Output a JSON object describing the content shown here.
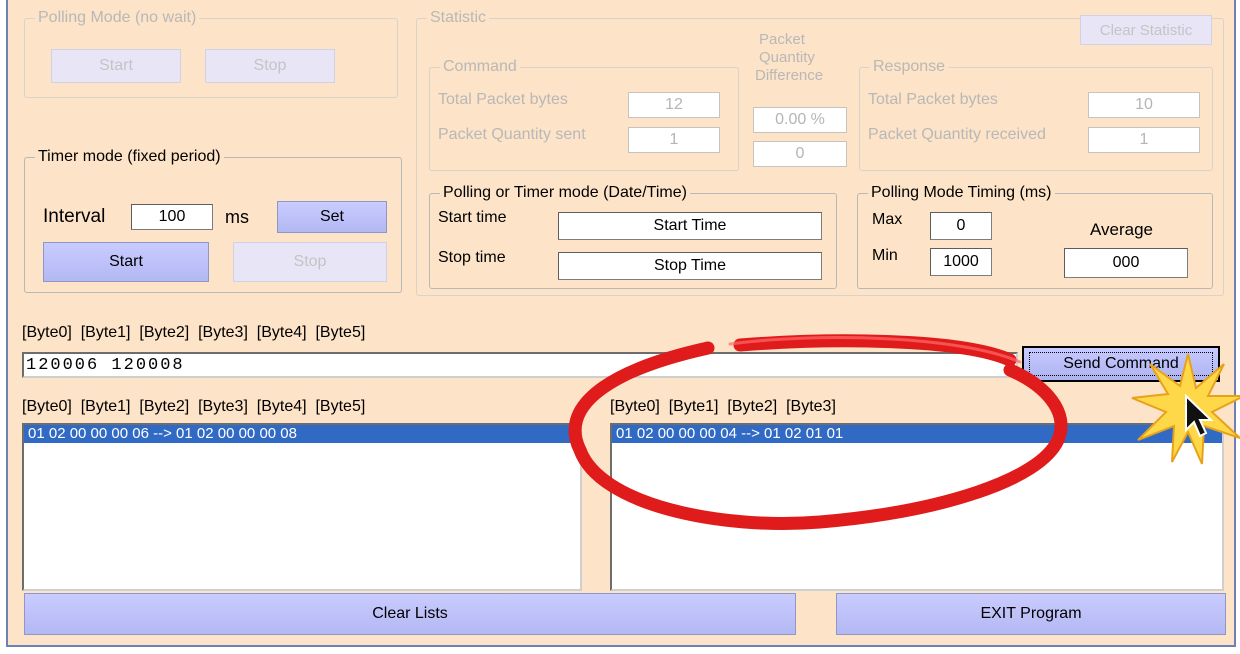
{
  "polling_mode": {
    "title": "Polling Mode (no wait)",
    "start_label": "Start",
    "stop_label": "Stop"
  },
  "timer_mode": {
    "title": "Timer mode (fixed period)",
    "interval_label": "Interval",
    "interval_value": "100",
    "unit_label": "ms",
    "set_label": "Set",
    "start_label": "Start",
    "stop_label": "Stop"
  },
  "statistic": {
    "title": "Statistic",
    "clear_label": "Clear Statistic",
    "command": {
      "title": "Command",
      "total_bytes_label": "Total Packet bytes",
      "total_bytes_value": "12",
      "qty_sent_label": "Packet Quantity sent",
      "qty_sent_value": "1"
    },
    "difference": {
      "title_line1": "Packet",
      "title_line2": "Quantity",
      "title_line3": "Difference",
      "percent_value": "0.00 %",
      "count_value": "0"
    },
    "response": {
      "title": "Response",
      "total_bytes_label": "Total Packet bytes",
      "total_bytes_value": "10",
      "qty_received_label": "Packet Quantity received",
      "qty_received_value": "1"
    },
    "datetime": {
      "title": "Polling  or Timer mode  (Date/Time)",
      "start_label": "Start time",
      "start_value": "Start Time",
      "stop_label": "Stop time",
      "stop_value": "Stop Time"
    },
    "timing": {
      "title": "Polling Mode Timing (ms)",
      "max_label": "Max",
      "max_value": "0",
      "min_label": "Min",
      "min_value": "1000",
      "average_label": "Average",
      "average_value": "000"
    }
  },
  "command": {
    "byte_header": "[Byte0]  [Byte1]  [Byte2]  [Byte3]  [Byte4]  [Byte5]",
    "input_value": "120006 120008",
    "send_label": "Send Command"
  },
  "sent_list": {
    "header": "[Byte0]  [Byte1]  [Byte2]  [Byte3]  [Byte4]  [Byte5]",
    "items": [
      "01 02 00 00 00 06 --> 01 02 00 00 00 08"
    ]
  },
  "response_list": {
    "header": "[Byte0]  [Byte1]  [Byte2]  [Byte3]",
    "items": [
      "01 02 00 00 00 04 --> 01 02 01 01"
    ]
  },
  "footer": {
    "clear_lists_label": "Clear Lists",
    "exit_label": "EXIT Program"
  },
  "colors": {
    "window_bg": "#fde3c7",
    "button_bg": "#b4b8f3",
    "selection": "#316ac5",
    "highlight_ellipse": "#e01b1b",
    "burst": "#ffd84a"
  }
}
